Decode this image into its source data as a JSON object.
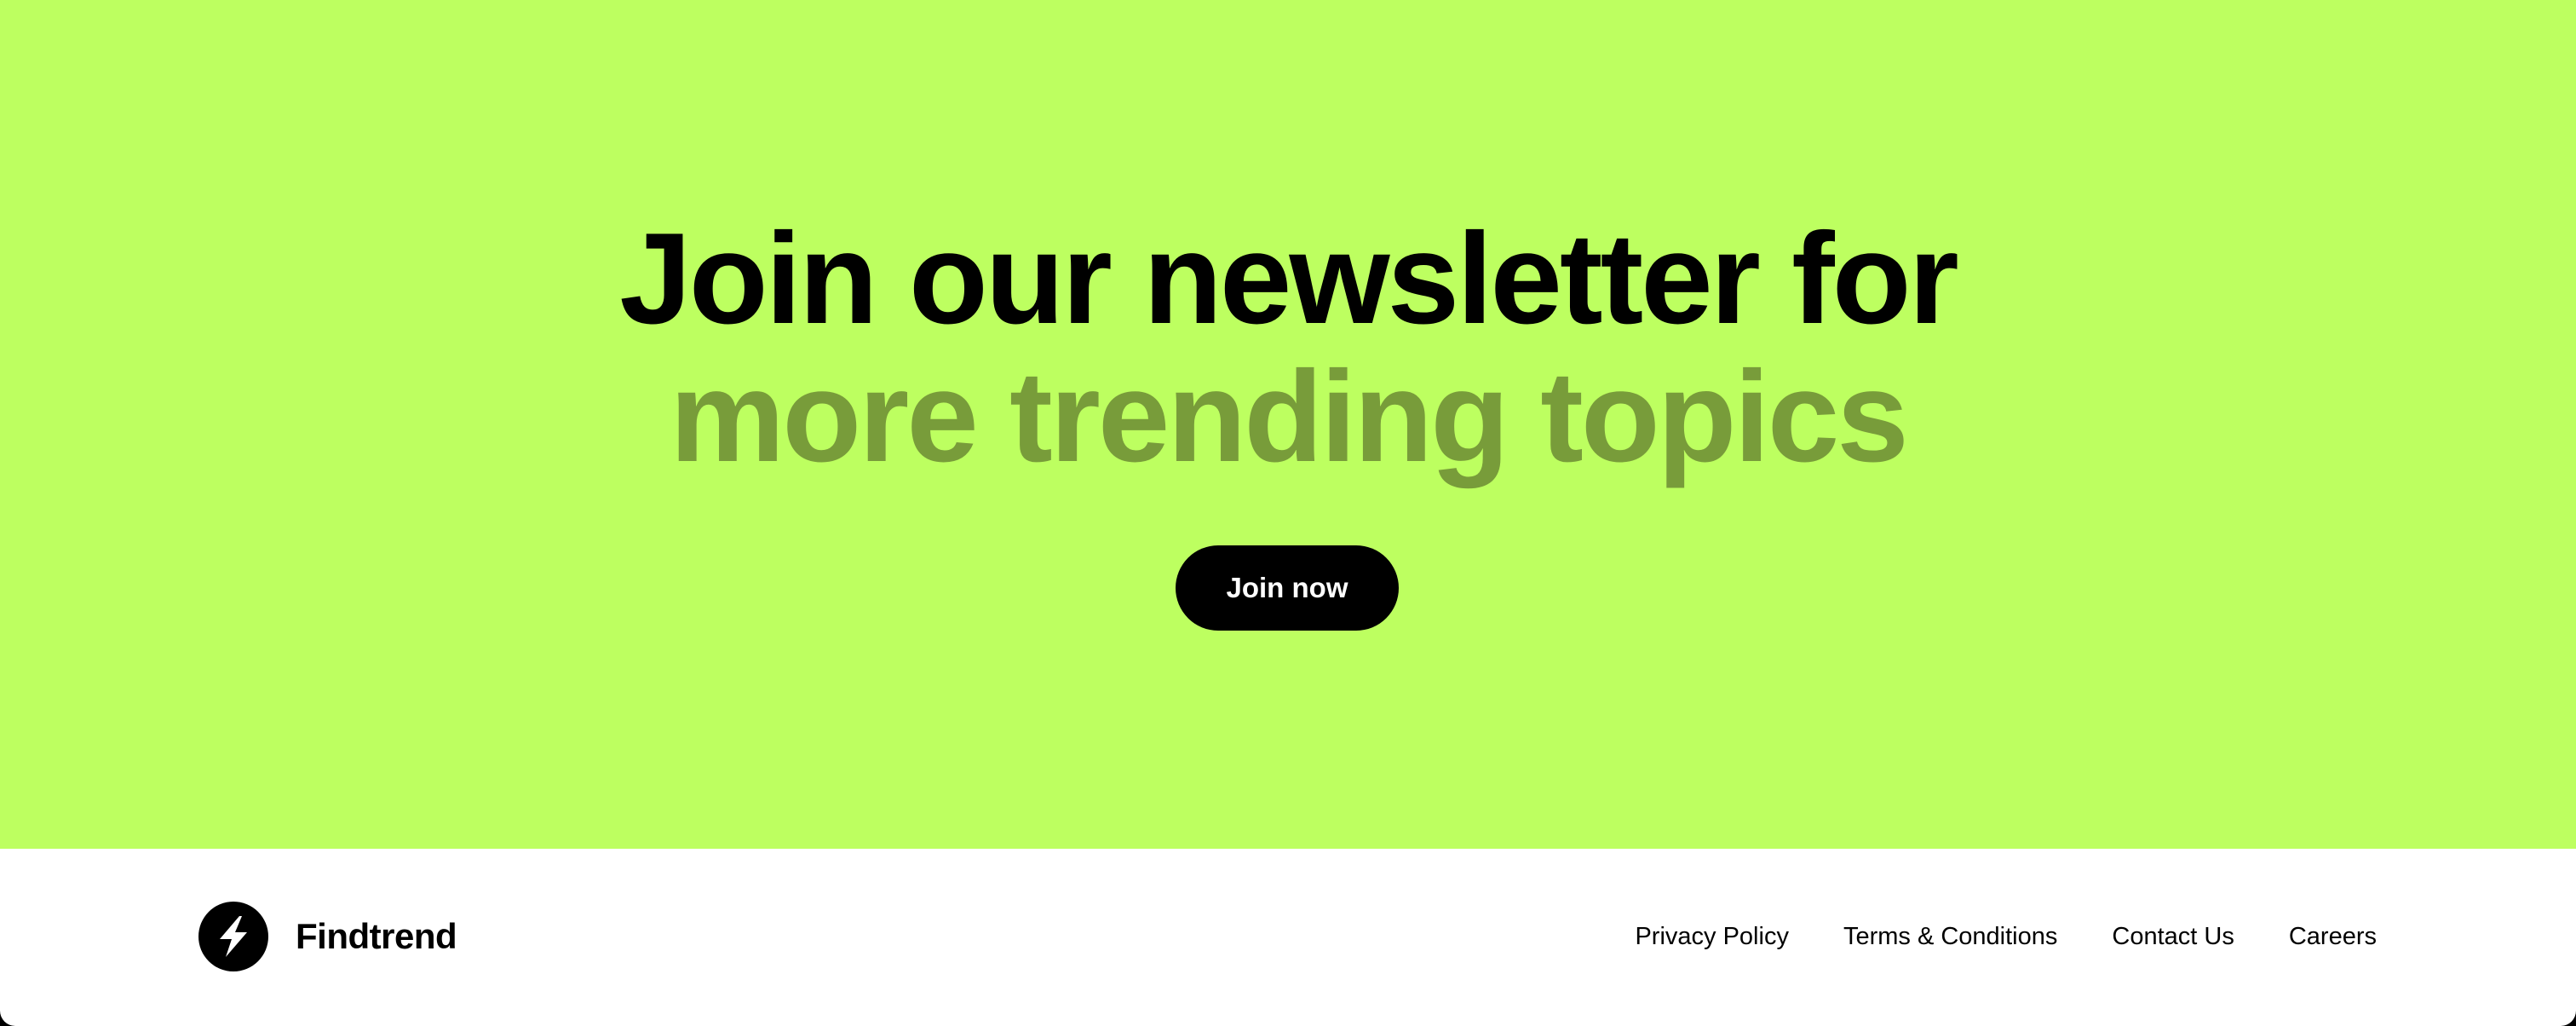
{
  "hero": {
    "headline_line1": "Join our newsletter for",
    "headline_line2": "more trending topics",
    "button_label": "Join now",
    "background_color": "#bdff60",
    "accent_text_color": "#789c3a"
  },
  "footer": {
    "logo_icon": "lightning-bolt-icon",
    "brand_name": "Findtrend",
    "links": [
      {
        "label": "Privacy Policy"
      },
      {
        "label": "Terms & Conditions"
      },
      {
        "label": "Contact Us"
      },
      {
        "label": "Careers"
      }
    ]
  }
}
